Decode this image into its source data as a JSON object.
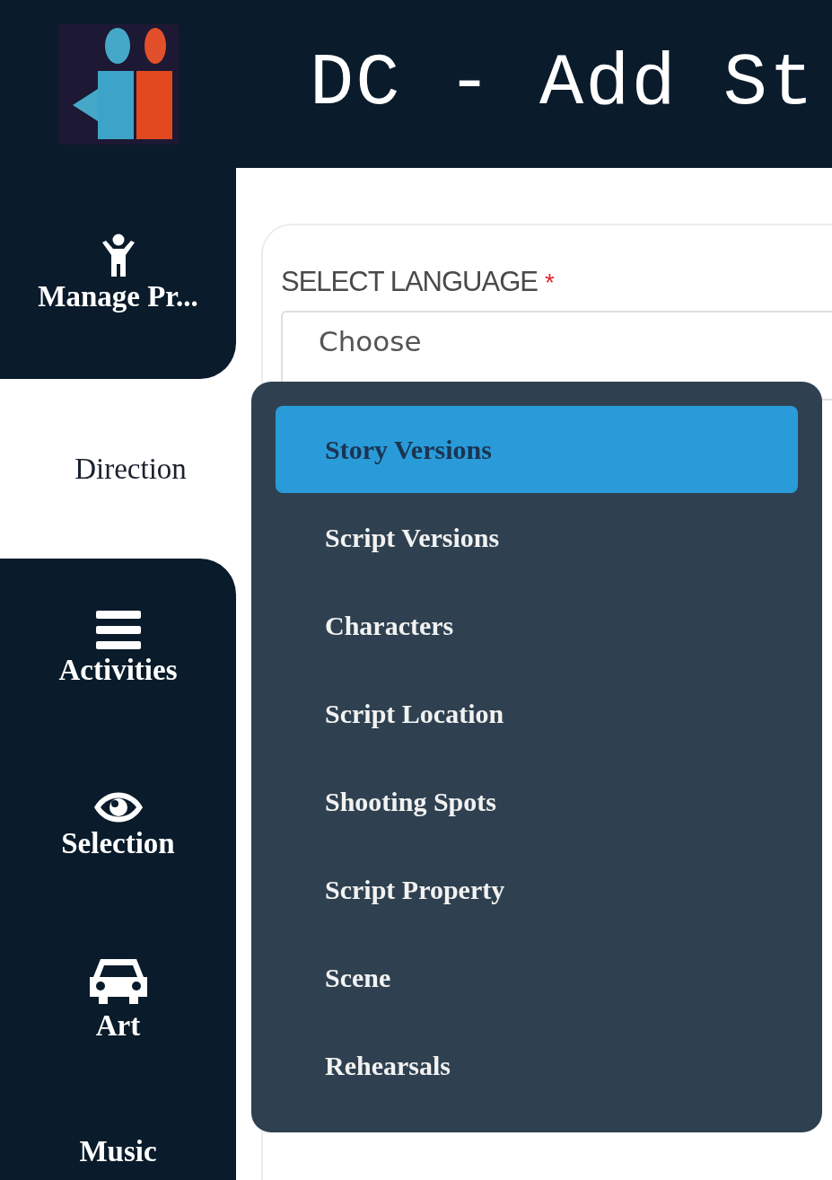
{
  "header": {
    "title": "DC - Add St"
  },
  "sidebar": {
    "items": [
      {
        "label": "Manage Pr...",
        "selected": false
      },
      {
        "label": "Direction",
        "selected": true
      },
      {
        "label": "Activities",
        "selected": false
      },
      {
        "label": "Selection",
        "selected": false
      },
      {
        "label": "Art",
        "selected": false
      },
      {
        "label": "Music",
        "selected": false
      }
    ]
  },
  "form": {
    "label": "SELECT LANGUAGE",
    "required_mark": "*",
    "select": {
      "value": "Choose"
    }
  },
  "menu": {
    "items": [
      {
        "label": "Story Versions",
        "selected": true
      },
      {
        "label": "Script Versions",
        "selected": false
      },
      {
        "label": "Characters",
        "selected": false
      },
      {
        "label": "Script Location",
        "selected": false
      },
      {
        "label": "Shooting Spots",
        "selected": false
      },
      {
        "label": "Script Property",
        "selected": false
      },
      {
        "label": "Scene",
        "selected": false
      },
      {
        "label": "Rehearsals",
        "selected": false
      }
    ]
  }
}
